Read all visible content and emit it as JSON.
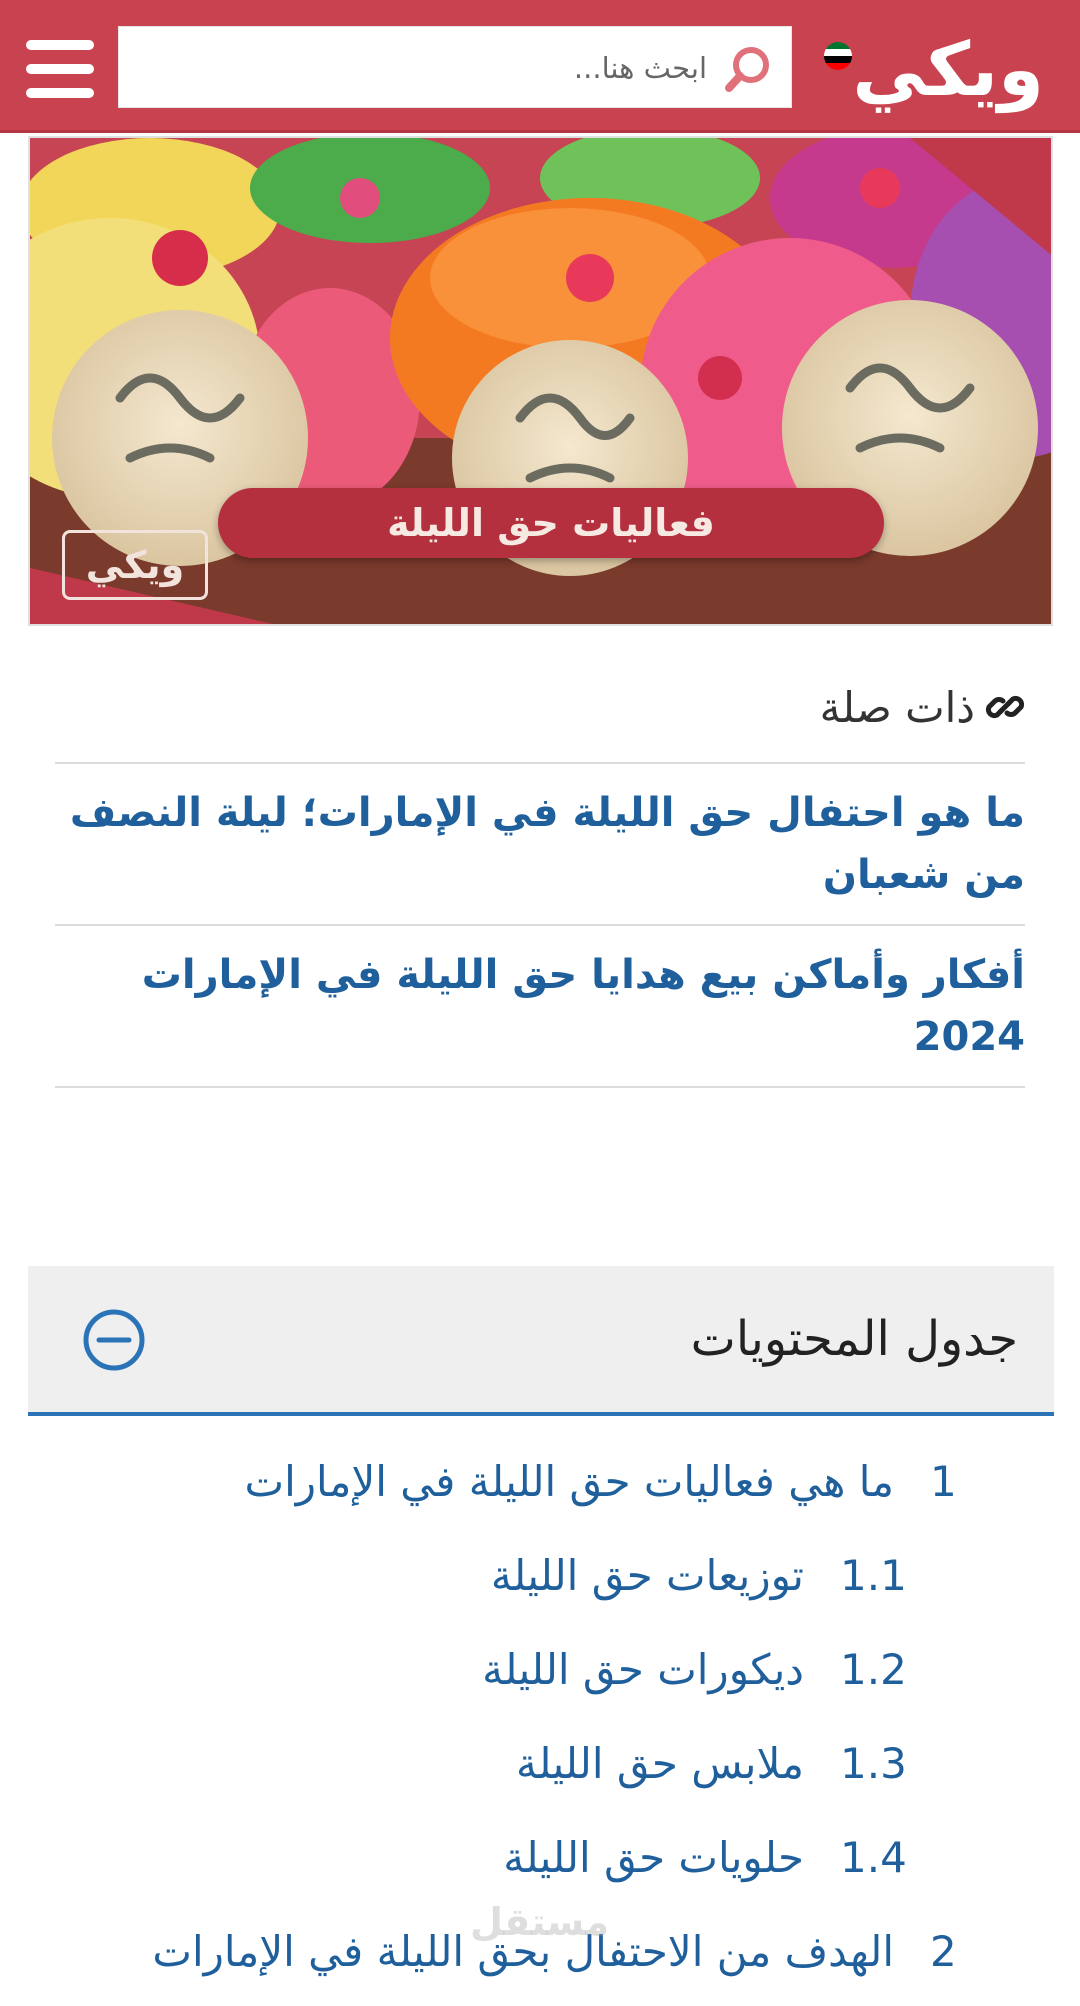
{
  "header": {
    "logo_text": "ويكي",
    "search_placeholder": "ابحث هنا...",
    "flag_colors": [
      "#00732f",
      "#ffffff",
      "#000000",
      "#ff0000"
    ]
  },
  "hero": {
    "caption": "فعاليات حق الليلة",
    "badge_logo": "ويكي"
  },
  "related": {
    "title": "ذات صلة",
    "items": [
      "ما هو احتفال حق الليلة في الإمارات؛ ليلة النصف من شعبان",
      "أفكار وأماكن بيع هدايا حق الليلة في الإمارات 2024"
    ]
  },
  "toc": {
    "title": "جدول المحتويات",
    "items": [
      {
        "num": "1",
        "label": "ما هي فعاليات حق الليلة في الإمارات"
      },
      {
        "num": "1.1",
        "label": "توزيعات حق الليلة"
      },
      {
        "num": "1.2",
        "label": "ديكورات حق الليلة"
      },
      {
        "num": "1.3",
        "label": "ملابس حق الليلة"
      },
      {
        "num": "1.4",
        "label": "حلويات حق الليلة"
      },
      {
        "num": "2",
        "label": "الهدف من الاحتفال بحق الليلة في الإمارات"
      }
    ]
  },
  "watermark": "مستقل",
  "colors": {
    "brand_red": "#c8434f",
    "link_blue": "#1f5f9b",
    "toc_accent": "#2b73b7"
  }
}
